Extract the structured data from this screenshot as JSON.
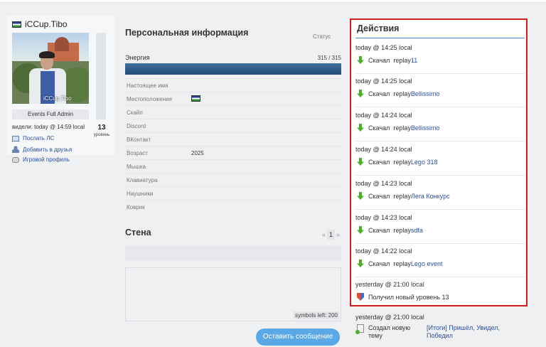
{
  "profile": {
    "username": "iCCup.Tibo",
    "avatar_caption": "iCCup.Tibo",
    "role": "Events Full Admin",
    "last_seen": "видели: today @ 14:59 local",
    "level": "13",
    "level_label": "уровень",
    "links": {
      "send_pm": "Послать ЛС",
      "add_friend": "Добавить в друзья",
      "game_profile": "Игровой профиль"
    }
  },
  "personal": {
    "title": "Персональная информация",
    "status_label": "Статус",
    "energy_label": "Энергия",
    "energy_value": "315 / 315",
    "energy_fraction": 1.0,
    "rows": [
      {
        "label": "Настоящее имя",
        "value": ""
      },
      {
        "label": "Местоположение",
        "value": ""
      },
      {
        "label": "Скайп",
        "value": ""
      },
      {
        "label": "Discord",
        "value": ""
      },
      {
        "label": "ВКонтакт",
        "value": ""
      },
      {
        "label": "Возраст",
        "value": "2025"
      },
      {
        "label": "Мышка",
        "value": ""
      },
      {
        "label": "Клавиатура",
        "value": ""
      },
      {
        "label": "Наушники",
        "value": ""
      },
      {
        "label": "Коврик",
        "value": ""
      }
    ]
  },
  "wall": {
    "title": "Стена",
    "pager_prev": "«",
    "pager_current": "1",
    "pager_next": "»",
    "symbols_left": "symbols left: 200",
    "send_button": "Оставить сообщение"
  },
  "actions": {
    "title": "Действия",
    "items": [
      {
        "time": "today @ 14:25 local",
        "verb": "Скачал",
        "prefix": "replay",
        "link": "11"
      },
      {
        "time": "today @ 14:25 local",
        "verb": "Скачал",
        "prefix": "replay",
        "link": "Bellissimo"
      },
      {
        "time": "today @ 14:24 local",
        "verb": "Скачал",
        "prefix": "replay",
        "link": "Bellissimo"
      },
      {
        "time": "today @ 14:24 local",
        "verb": "Скачал",
        "prefix": "replay",
        "link": "Lego 318"
      },
      {
        "time": "today @ 14:23 local",
        "verb": "Скачал",
        "prefix": "replay",
        "link": "Лега Конкурс"
      },
      {
        "time": "today @ 14:23 local",
        "verb": "Скачал",
        "prefix": "replay",
        "link": "sdfa"
      },
      {
        "time": "today @ 14:22 local",
        "verb": "Скачал",
        "prefix": "replay",
        "link": "Lego event"
      }
    ],
    "level_item": {
      "time": "yesterday @ 21:00 local",
      "text": "Получил новый уровень 13"
    },
    "topic_item": {
      "time": "yesterday @ 21:00 local",
      "text_line1": "Создал новую",
      "text_line2": "тему",
      "link_line1": "[Итоги] Пришёл, Увидел,",
      "link_line2": "Победил"
    }
  },
  "colors": {
    "highlight_border": "#d31f1f",
    "link": "#2a4fa3",
    "button": "#5aa8e6",
    "energy": "#234d74"
  }
}
